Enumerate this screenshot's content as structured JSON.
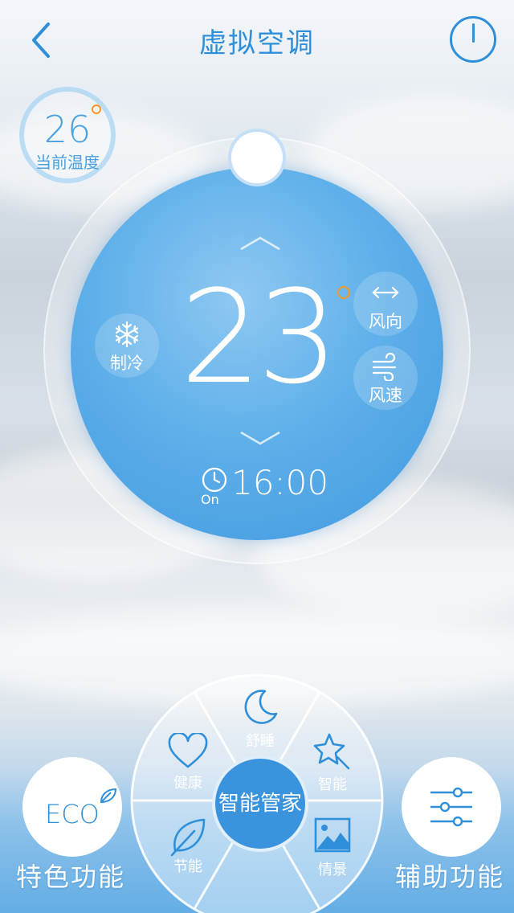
{
  "header": {
    "title": "虚拟空调",
    "back_icon": "chevron-left-icon",
    "power_icon": "power-icon"
  },
  "current_temp": {
    "value": "26",
    "label": "当前温度"
  },
  "dial": {
    "set_temp": "23",
    "mode_label": "制冷",
    "mode_icon": "snowflake-icon",
    "wind_direction_label": "风向",
    "wind_direction_icon": "horizontal-arrows-icon",
    "wind_speed_label": "风速",
    "wind_speed_icon": "wind-icon"
  },
  "timer": {
    "time": "16:00",
    "status": "On",
    "icon": "timer-icon"
  },
  "smart_menu": {
    "center_label": "智能管家",
    "items": [
      {
        "label": "舒睡",
        "icon": "moon-icon"
      },
      {
        "label": "健康",
        "icon": "heart-icon"
      },
      {
        "label": "智能",
        "icon": "star-wand-icon"
      },
      {
        "label": "节能",
        "icon": "leaf-icon"
      },
      {
        "label": "情景",
        "icon": "picture-icon"
      }
    ]
  },
  "bottom": {
    "left_label": "特色功能",
    "left_icon_text": "ECO",
    "right_label": "辅助功能",
    "right_icon": "sliders-icon"
  },
  "colors": {
    "accent": "#2f8fd8",
    "dial": "#5fb0ea",
    "degree": "#f39a23",
    "center_button": "#3a93dd"
  }
}
